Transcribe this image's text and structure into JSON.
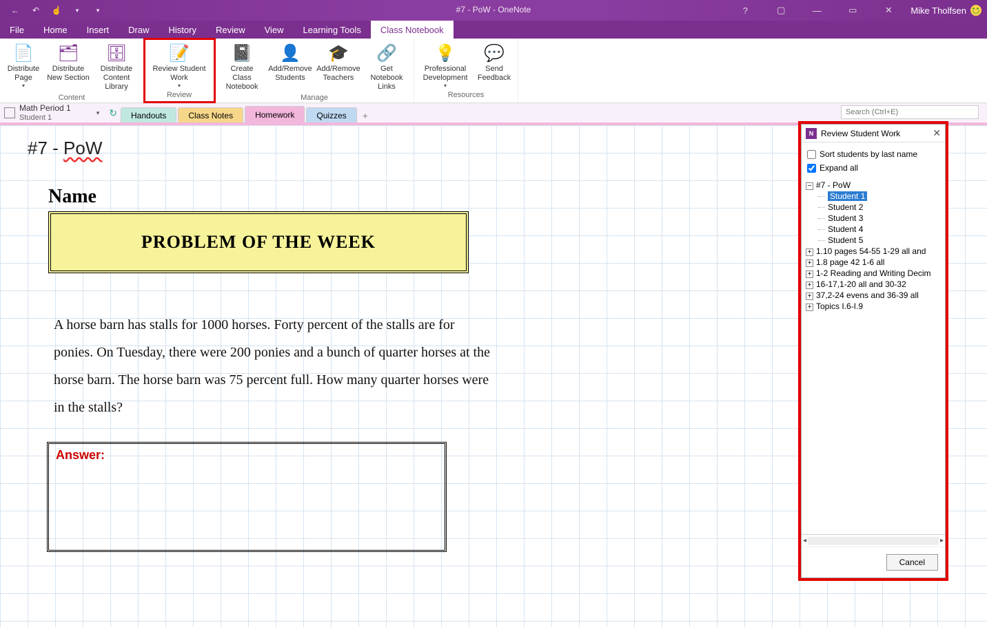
{
  "window": {
    "title": "#7 - PoW - OneNote",
    "user": "Mike Tholfsen"
  },
  "menu": {
    "tabs": [
      "File",
      "Home",
      "Insert",
      "Draw",
      "History",
      "Review",
      "View",
      "Learning Tools",
      "Class Notebook"
    ],
    "active": "Class Notebook"
  },
  "ribbon": {
    "groups": [
      {
        "name": "Content",
        "items": [
          {
            "id": "distribute-page",
            "label": "Distribute Page",
            "caret": true
          },
          {
            "id": "distribute-new-section",
            "label": "Distribute New Section"
          },
          {
            "id": "distribute-content-library",
            "label": "Distribute Content Library"
          }
        ]
      },
      {
        "name": "Review",
        "highlight": true,
        "items": [
          {
            "id": "review-student-work",
            "label": "Review Student Work",
            "caret": true
          }
        ]
      },
      {
        "name": "Manage",
        "items": [
          {
            "id": "create-class-notebook",
            "label": "Create Class Notebook"
          },
          {
            "id": "add-remove-students",
            "label": "Add/Remove Students"
          },
          {
            "id": "add-remove-teachers",
            "label": "Add/Remove Teachers"
          },
          {
            "id": "get-notebook-links",
            "label": "Get Notebook Links"
          }
        ]
      },
      {
        "name": "Resources",
        "items": [
          {
            "id": "professional-development",
            "label": "Professional Development",
            "caret": true
          },
          {
            "id": "send-feedback",
            "label": "Send Feedback"
          }
        ]
      }
    ]
  },
  "notebook": {
    "name": "Math Period 1",
    "subname": "Student 1",
    "sections": [
      {
        "id": "handouts",
        "label": "Handouts"
      },
      {
        "id": "classnotes",
        "label": "Class Notes"
      },
      {
        "id": "homework",
        "label": "Homework",
        "active": true
      },
      {
        "id": "quizzes",
        "label": "Quizzes"
      }
    ],
    "search_placeholder": "Search (Ctrl+E)"
  },
  "page_content": {
    "title_prefix": "#7 - ",
    "title_word": "PoW",
    "name_label": "Name",
    "banner": "PROBLEM OF THE WEEK",
    "body": "A horse barn has stalls for 1000 horses. Forty percent of the stalls are for ponies. On Tuesday, there were 200 ponies and a bunch of quarter horses at the horse barn. The horse barn was 75 percent full. How many quarter horses were in the stalls?",
    "answer_label": "Answer:"
  },
  "panel": {
    "title": "Review Student Work",
    "sort_label": "Sort students by last name",
    "sort_checked": false,
    "expand_label": "Expand all",
    "expand_checked": true,
    "tree": {
      "expanded": {
        "label": "#7 - PoW",
        "students": [
          "Student 1",
          "Student 2",
          "Student 3",
          "Student 4",
          "Student 5"
        ],
        "selected": "Student 1"
      },
      "collapsed": [
        "1.10 pages 54-55 1-29 all and",
        "1.8 page 42 1-6 all",
        "1-2 Reading and Writing Decim",
        "16-17,1-20 all and 30-32",
        "37,2-24 evens and 36-39 all",
        "Topics I.6-I.9"
      ]
    },
    "cancel": "Cancel"
  }
}
